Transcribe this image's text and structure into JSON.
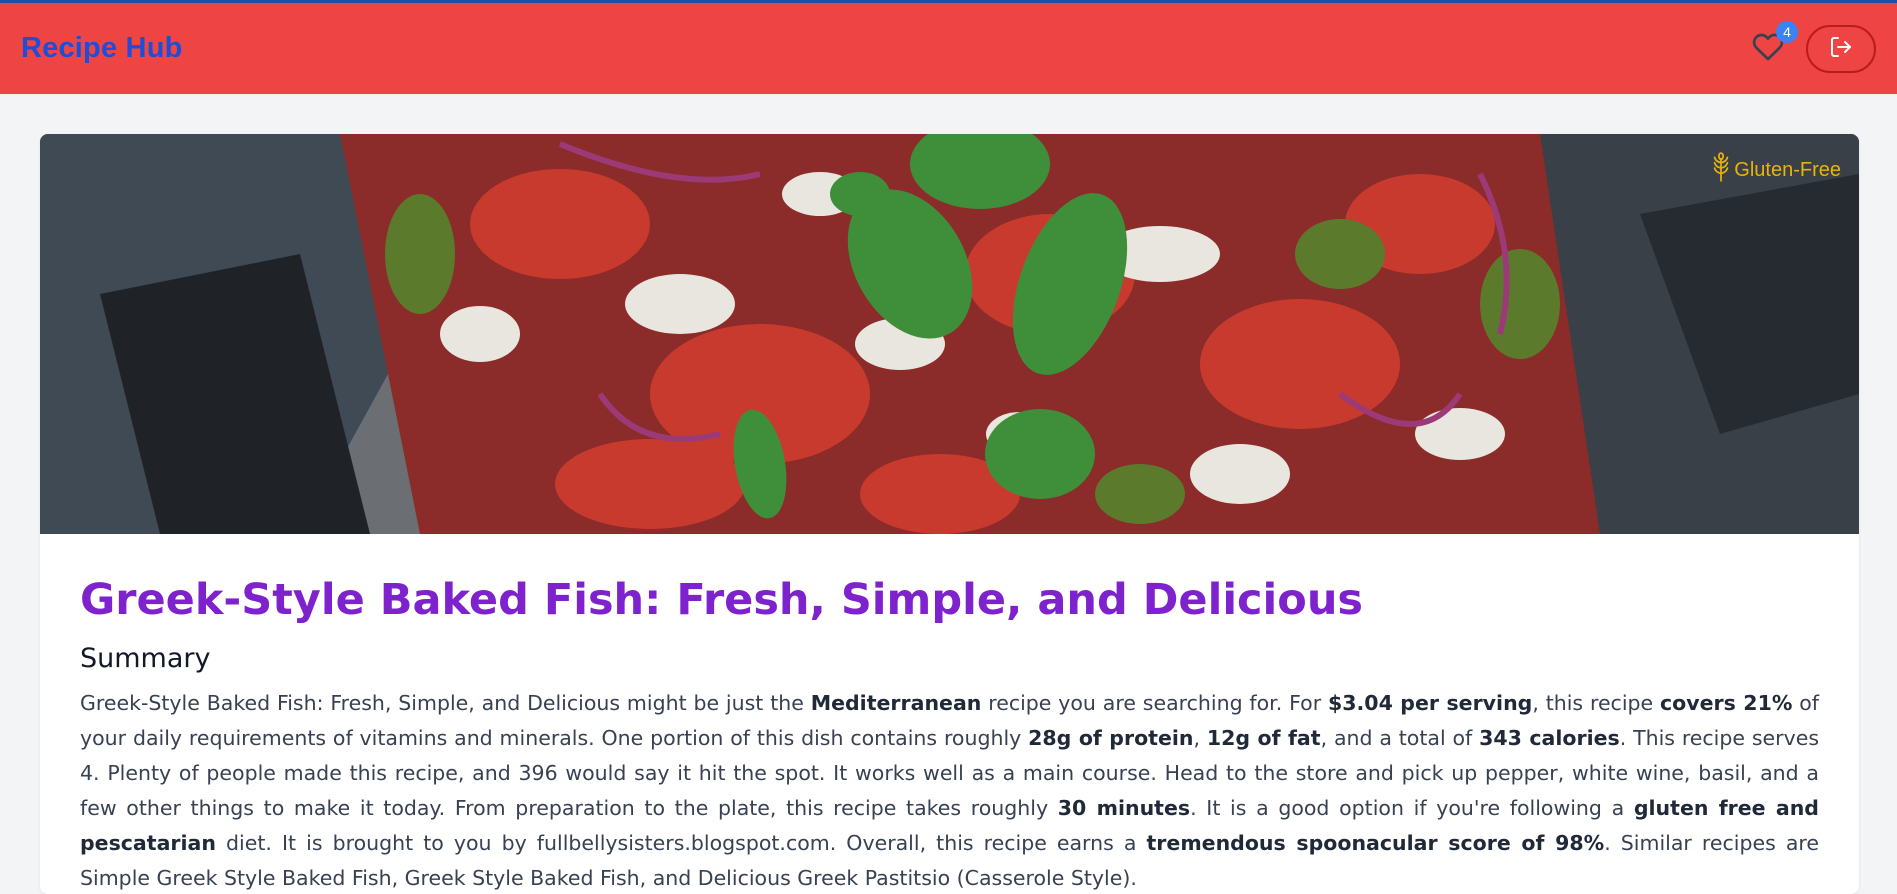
{
  "app": {
    "brand": "Recipe Hub",
    "favorites_count": "4",
    "accent_color": "#ef4444",
    "brand_color": "#1d4ed8"
  },
  "icons": {
    "favorites": "heart-icon",
    "logout": "logout-icon",
    "diet": "wheat-icon"
  },
  "recipe": {
    "diet_badge": "Gluten-Free",
    "title": "Greek-Style Baked Fish: Fresh, Simple, and Delicious",
    "title_color": "#7e22ce",
    "summary_heading": "Summary",
    "summary": {
      "s1": "Greek-Style Baked Fish: Fresh, Simple, and Delicious might be just the ",
      "b1": "Mediterranean",
      "s2": " recipe you are searching for. For ",
      "b2": "$3.04 per serving",
      "s3": ", this recipe ",
      "b3": "covers 21%",
      "s4": " of your daily requirements of vitamins and minerals. One portion of this dish contains roughly ",
      "b4": "28g of protein",
      "s5": ", ",
      "b5": "12g of fat",
      "s6": ", and a total of ",
      "b6": "343 calories",
      "s7": ". This recipe serves 4. Plenty of people made this recipe, and 396 would say it hit the spot. It works well as a main course. Head to the store and pick up pepper, white wine, basil, and a few other things to make it today. From preparation to the plate, this recipe takes roughly ",
      "b7": "30 minutes",
      "s8": ". It is a good option if you're following a ",
      "b8": "gluten free and pescatarian",
      "s9": " diet. It is brought to you by fullbellysisters.blogspot.com. Overall, this recipe earns a ",
      "b9": "tremendous spoonacular score of 98%",
      "s10": ". Similar recipes are Simple Greek Style Baked Fish, Greek Style Baked Fish, and Delicious Greek Pastitsio (Casserole Style)."
    }
  }
}
